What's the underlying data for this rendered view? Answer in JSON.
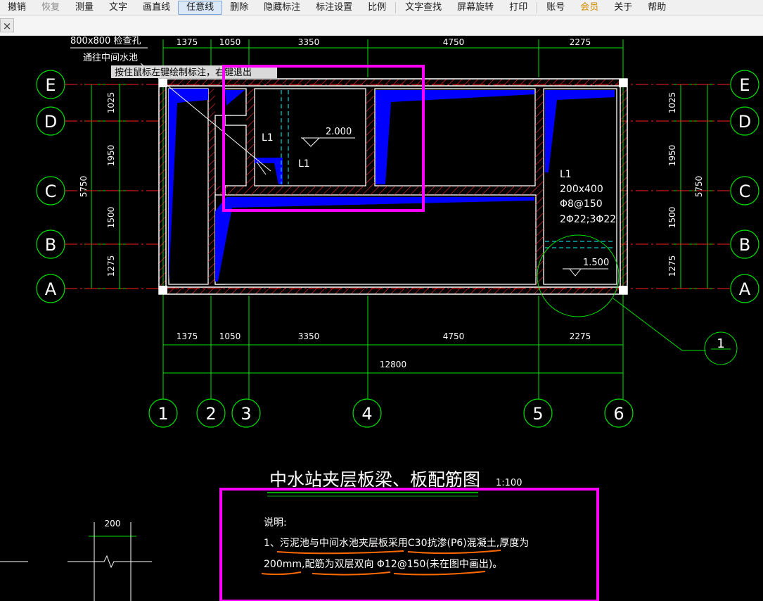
{
  "toolbar": {
    "items": [
      {
        "label": "撤销",
        "state": "normal"
      },
      {
        "label": "恢复",
        "state": "disabled"
      },
      {
        "label": "测量",
        "state": "normal"
      },
      {
        "label": "文字",
        "state": "normal"
      },
      {
        "label": "画直线",
        "state": "normal"
      },
      {
        "label": "任意线",
        "state": "active"
      },
      {
        "label": "删除",
        "state": "normal"
      },
      {
        "label": "隐藏标注",
        "state": "normal"
      },
      {
        "label": "标注设置",
        "state": "normal"
      },
      {
        "label": "比例",
        "state": "normal"
      },
      {
        "label": "文字查找",
        "state": "normal"
      },
      {
        "label": "屏幕旋转",
        "state": "normal"
      },
      {
        "label": "打印",
        "state": "normal"
      },
      {
        "label": "账号",
        "state": "normal"
      },
      {
        "label": "会员",
        "state": "vip"
      },
      {
        "label": "关于",
        "state": "normal"
      },
      {
        "label": "帮助",
        "state": "normal"
      }
    ]
  },
  "tabbar": {
    "close_symbol": "×"
  },
  "drawing": {
    "top_texts": {
      "note1": "800x800 检查孔",
      "note2": "通往中间水池"
    },
    "tooltip": {
      "text": "按住鼠标左键绘制标注，右键退出"
    },
    "top_dims": [
      "1375",
      "1050",
      "3350",
      "4750",
      "2275"
    ],
    "bottom_dims": [
      "1375",
      "1050",
      "3350",
      "4750",
      "2275"
    ],
    "overall_dim": "12800",
    "left_dims": [
      "1025",
      "1950",
      "1500",
      "1275"
    ],
    "right_dims": [
      "1025",
      "1950",
      "1500",
      "1275"
    ],
    "total_height_dim": "5750",
    "row_axes": [
      "E",
      "D",
      "C",
      "B",
      "A"
    ],
    "col_axes": [
      "1",
      "2",
      "3",
      "4",
      "5",
      "6"
    ],
    "beam_label": "L1",
    "beam_spec": [
      "L1",
      "200x400",
      "Φ8@150",
      "2Φ22;3Φ22"
    ],
    "elev_2000": "2.000",
    "elev_1500": "1.500",
    "detail_mark": "1",
    "drawing_title": "中水站夹层板梁、板配筋图",
    "scale": "1:100",
    "note_title": "说明:",
    "note_line1": "1、污泥池与中间水池夹层板采用C30抗渗(P6)混凝土,厚度为",
    "note_line2": "200mm,配筋为双层双向 Φ12@150(未在图中画出)。",
    "section_dim": "200",
    "colors": {
      "axis": "#ff2020",
      "dim": "#00e000",
      "wall": "#ffffff",
      "fill": "#0000ff",
      "cyan": "#00ffff",
      "magenta": "#ff00ff",
      "hatch": "#ff3030",
      "text": "#ffffff",
      "orange": "#ff6a00"
    }
  }
}
